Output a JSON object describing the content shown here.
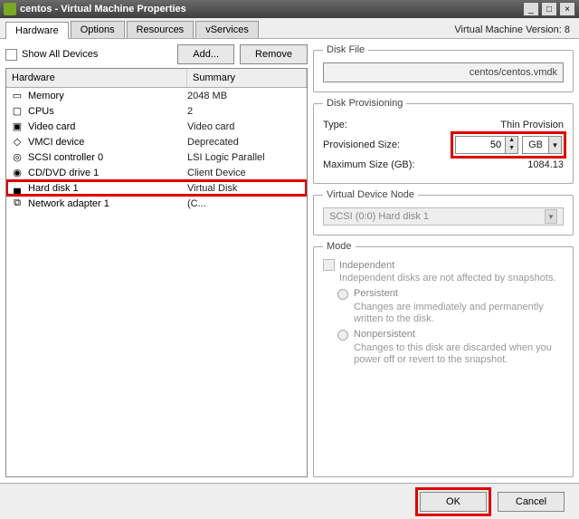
{
  "window": {
    "title": "centos - Virtual Machine Properties"
  },
  "winbtns": {
    "min": "_",
    "max": "□",
    "close": "×"
  },
  "tabs": {
    "hardware": "Hardware",
    "options": "Options",
    "resources": "Resources",
    "vservices": "vServices"
  },
  "version": "Virtual Machine Version: 8",
  "top": {
    "show_all": "Show All Devices",
    "add": "Add...",
    "remove": "Remove"
  },
  "cols": {
    "hardware": "Hardware",
    "summary": "Summary"
  },
  "hw": [
    {
      "name": "Memory",
      "summary": "2048 MB",
      "icon": "memory-icon"
    },
    {
      "name": "CPUs",
      "summary": "2",
      "icon": "cpu-icon"
    },
    {
      "name": "Video card",
      "summary": "Video card",
      "icon": "video-icon"
    },
    {
      "name": "VMCI device",
      "summary": "Deprecated",
      "icon": "vmci-icon"
    },
    {
      "name": "SCSI controller 0",
      "summary": "LSI Logic Parallel",
      "icon": "scsi-icon"
    },
    {
      "name": "CD/DVD drive 1",
      "summary": "Client Device",
      "icon": "cd-icon"
    },
    {
      "name": "Hard disk 1",
      "summary": "Virtual Disk",
      "icon": "disk-icon"
    },
    {
      "name": "Network adapter 1",
      "summary": "(C...",
      "icon": "nic-icon"
    }
  ],
  "diskfile": {
    "legend": "Disk File",
    "path": "centos/centos.vmdk"
  },
  "prov": {
    "legend": "Disk Provisioning",
    "type_label": "Type:",
    "type_value": "Thin Provision",
    "provsize_label": "Provisioned Size:",
    "provsize_value": "50",
    "provsize_unit": "GB",
    "maxsize_label": "Maximum Size (GB):",
    "maxsize_value": "1084.13"
  },
  "vnode": {
    "legend": "Virtual Device Node",
    "value": "SCSI (0:0) Hard disk 1"
  },
  "mode": {
    "legend": "Mode",
    "independent": "Independent",
    "desc1": "Independent disks are not affected by snapshots.",
    "persistent": "Persistent",
    "persistent_desc": "Changes are immediately and permanently written to the disk.",
    "nonpersistent": "Nonpersistent",
    "nonpersistent_desc": "Changes to this disk are discarded when you power off or revert to the snapshot."
  },
  "footer": {
    "ok": "OK",
    "cancel": "Cancel"
  },
  "icons": {
    "memory": "▭",
    "cpu": "▢",
    "video": "▣",
    "vmci": "◇",
    "scsi": "◎",
    "cd": "◉",
    "disk": "▄",
    "nic": "⧉"
  }
}
